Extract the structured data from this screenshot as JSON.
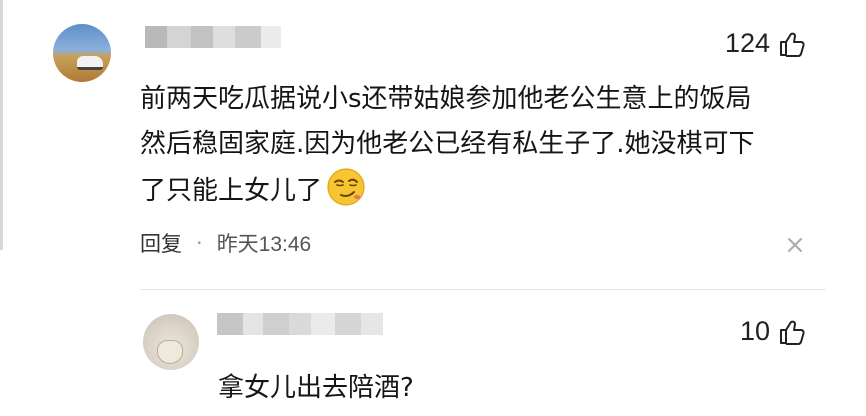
{
  "comments": [
    {
      "likes": "124",
      "text_lines": [
        "前两天吃瓜据说小s还带姑娘参加他老公生意上的饭局",
        "然后稳固家庭.因为他老公已经有私生子了.她没棋可下",
        "了只能上女儿了"
      ],
      "emoji": "smirk-emoji",
      "reply_label": "回复",
      "separator": "·",
      "time": "昨天13:46"
    },
    {
      "likes": "10",
      "text": "拿女儿出去陪酒?"
    }
  ],
  "icons": {
    "like": "thumbs-up-icon",
    "close": "close-icon"
  },
  "colors": {
    "text": "#151515",
    "meta": "#555555",
    "blur": "#c9c9c9"
  }
}
